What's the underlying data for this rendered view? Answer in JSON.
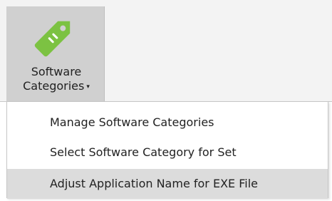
{
  "ribbon": {
    "button": {
      "label_line1": "Software",
      "label_line2": "Categories",
      "dropdown_arrow": "▾",
      "icon": "tag-icon",
      "icon_color": "#7cc242"
    }
  },
  "menu": {
    "items": [
      {
        "label": "Manage Software Categories"
      },
      {
        "label": "Select Software Category for Set"
      },
      {
        "label": "Adjust Application Name for EXE File",
        "highlighted": true
      }
    ],
    "highlight_color": "#dcdcdc"
  }
}
